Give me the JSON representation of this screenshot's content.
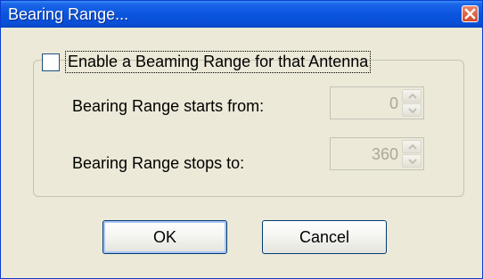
{
  "window": {
    "title": "Bearing Range..."
  },
  "group": {
    "checkbox_label": "Enable a Beaming Range for that Antenna",
    "checked": false
  },
  "fields": {
    "start_label": "Bearing Range starts from:",
    "start_value": "0",
    "stop_label": "Bearing Range stops to:",
    "stop_value": "360"
  },
  "buttons": {
    "ok_label": "OK",
    "cancel_label": "Cancel"
  },
  "colors": {
    "titlebar": "#0a55de",
    "dialog_bg": "#ece9d8",
    "disabled_text": "#aca899"
  }
}
